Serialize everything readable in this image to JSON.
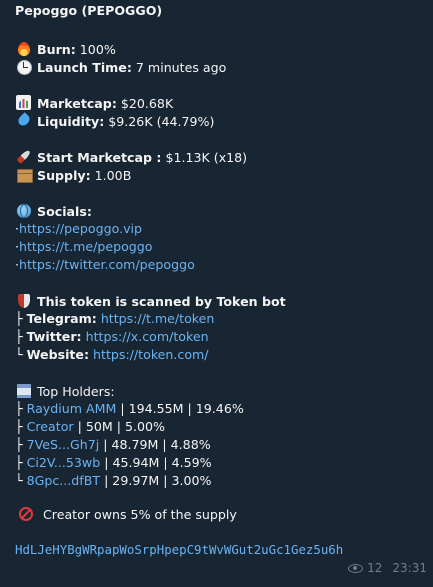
{
  "title": "Pepoggo (PEPOGGO)",
  "stats": {
    "burn_label": "Burn:",
    "burn_value": "100%",
    "launch_label": "Launch Time:",
    "launch_value": "7 minutes ago",
    "mcap_label": "Marketcap:",
    "mcap_value": "$20.68K",
    "liq_label": "Liquidity:",
    "liq_value": "$9.26K (44.79%)",
    "start_label": "Start Marketcap :",
    "start_value": "$1.13K (x18)",
    "supply_label": "Supply:",
    "supply_value": "1.00B"
  },
  "socials": {
    "label": "Socials:",
    "bullet": "·",
    "links": [
      "https://pepoggo.vip",
      "https://t.me/pepoggo",
      "https://twitter.com/pepoggo"
    ]
  },
  "scan": {
    "label": "This token is scanned by Token bot",
    "telegram_prefix": "├ ",
    "telegram_label": "Telegram:",
    "telegram_link": "https://t.me/token",
    "twitter_prefix": "├ ",
    "twitter_label": "Twitter:",
    "twitter_link": "https://x.com/token",
    "website_prefix": "└ ",
    "website_label": "Website:",
    "website_link": "https://token.com/"
  },
  "holders": {
    "label": "Top Holders:",
    "rows": [
      {
        "prefix": "├ ",
        "name": "Raydium AMM",
        "rest": " | 194.55M | 19.46%"
      },
      {
        "prefix": "├ ",
        "name": "Creator",
        "rest": " | 50M | 5.00%"
      },
      {
        "prefix": "├ ",
        "name": "7VeS...Gh7j",
        "rest": " | 48.79M | 4.88%"
      },
      {
        "prefix": "├ ",
        "name": "Ci2V...53wb",
        "rest": " | 45.94M | 4.59%"
      },
      {
        "prefix": "└ ",
        "name": "8Gpc...dfBT",
        "rest": " | 29.97M | 3.00%"
      }
    ]
  },
  "creator_note": "Creator owns 5% of the supply",
  "contract_address": "HdLJeHYBgWRpapWoSrpHpepC9tWvWGut2uGc1Gez5u6h",
  "meta": {
    "views": "12",
    "time": "23:31"
  },
  "icons": {
    "burn": "fire-icon",
    "launch": "clock-icon",
    "mcap": "chart-icon",
    "liq": "droplet-icon",
    "start": "rocket-icon",
    "supply": "package-icon",
    "socials": "globe-icon",
    "scan": "shield-icon",
    "holders": "bank-icon",
    "creator": "no-entry-icon",
    "views": "eye-icon"
  },
  "colors": {
    "background": "#182533",
    "link": "#6ab3f3",
    "text": "#f5f5f5",
    "meta": "#6d7f8f"
  }
}
